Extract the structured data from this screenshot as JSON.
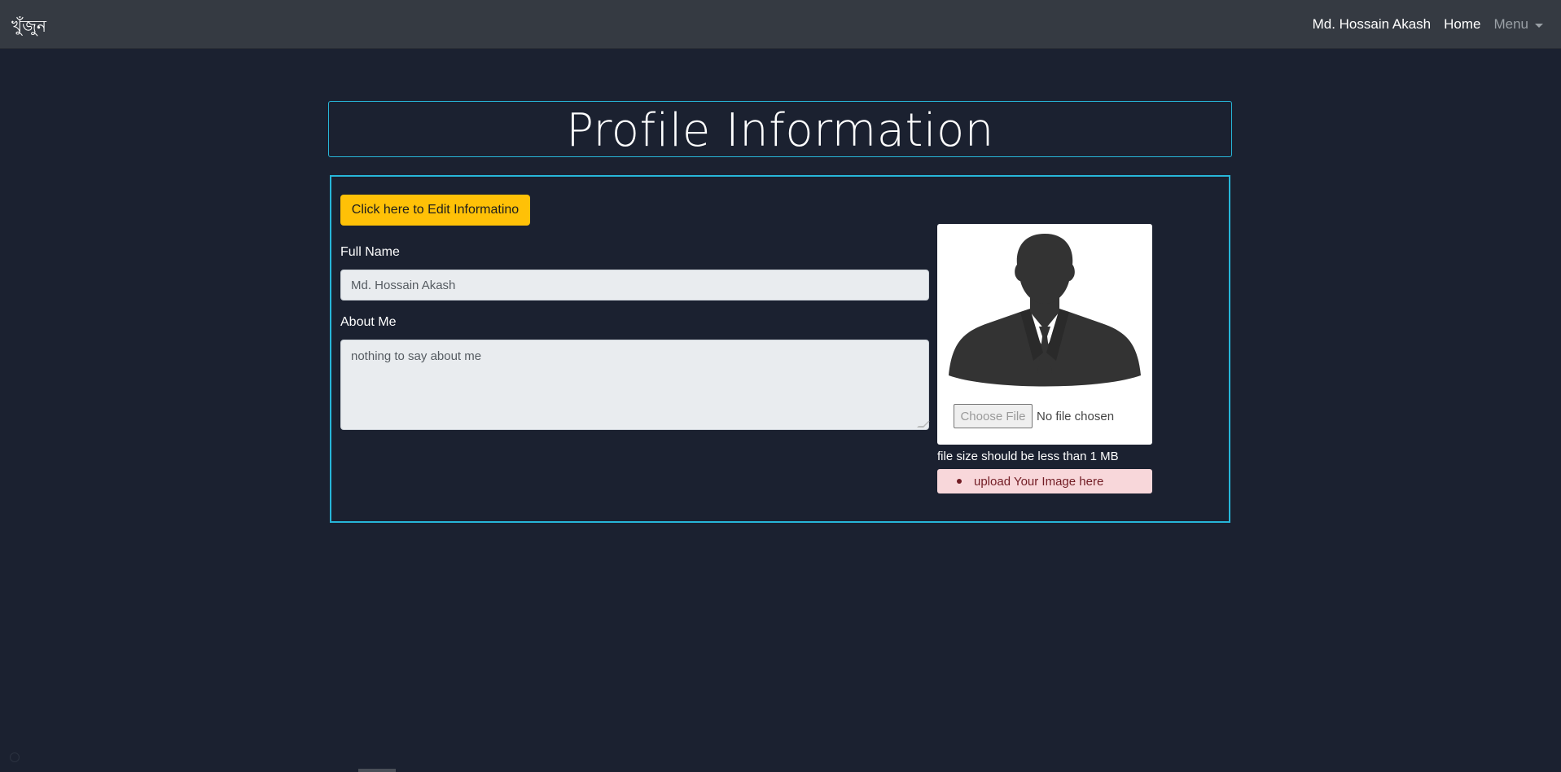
{
  "navbar": {
    "brand": "খুঁজুন",
    "user_name": "Md. Hossain Akash",
    "home_label": "Home",
    "menu_label": "Menu"
  },
  "page": {
    "title": "Profile Information"
  },
  "form": {
    "edit_button_label": "Click here to Edit Informatino",
    "full_name_label": "Full Name",
    "full_name_value": "Md. Hossain Akash",
    "about_me_label": "About Me",
    "about_me_value": "nothing to say about me"
  },
  "photo": {
    "choose_file_label": "Choose File",
    "no_file_text": "No file chosen",
    "size_note": "file size should be less than 1 MB",
    "alert_item": "upload Your Image here",
    "avatar_icon": "person-silhouette-icon"
  },
  "colors": {
    "background": "#1b2130",
    "navbar": "#353a42",
    "accent_border": "#27b6d8",
    "warning_button": "#ffc107",
    "alert_bg": "#f8d7da",
    "alert_text": "#721c24"
  }
}
